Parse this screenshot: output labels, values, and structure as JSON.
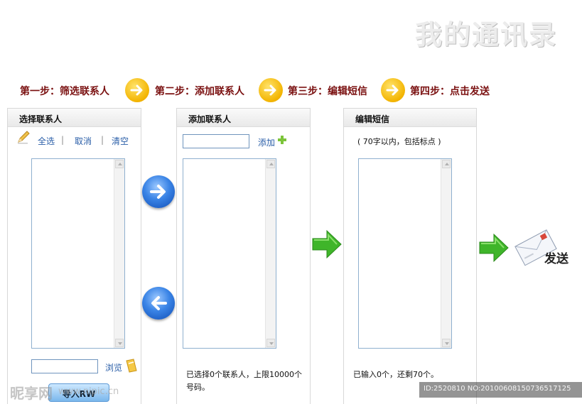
{
  "page_title": "我的通讯录",
  "steps": [
    {
      "label": "第一步：筛选联系人"
    },
    {
      "label": "第二步：添加联系人"
    },
    {
      "label": "第三步：编辑短信"
    },
    {
      "label": "第四步：点击发送"
    }
  ],
  "panel_select": {
    "title": "选择联系人",
    "select_all": "全选",
    "cancel": "取消",
    "clear": "清空",
    "separator": "|",
    "browse": "浏览",
    "browse_input_value": "",
    "button_label": "导入RW"
  },
  "panel_add": {
    "title": "添加联系人",
    "add_input_value": "",
    "add_label": "添加",
    "status": "已选择0个联系人，上限10000个号码。"
  },
  "panel_edit": {
    "title": "编辑短信",
    "hint": "( 70字以内，包括标点 )",
    "status": "已输入0个，还剩70个。"
  },
  "send": {
    "label": "发送"
  },
  "watermark": {
    "brand": "昵享网",
    "url": "www.nipic.cn",
    "id_text": "ID:2520810 NO:20100608150736517125"
  },
  "colors": {
    "step_text": "#7a1010",
    "link": "#2a5ea8",
    "nav_arrow": "#3a84e6",
    "green_arrow": "#3fb52a",
    "step_circle": "#f3b400"
  }
}
